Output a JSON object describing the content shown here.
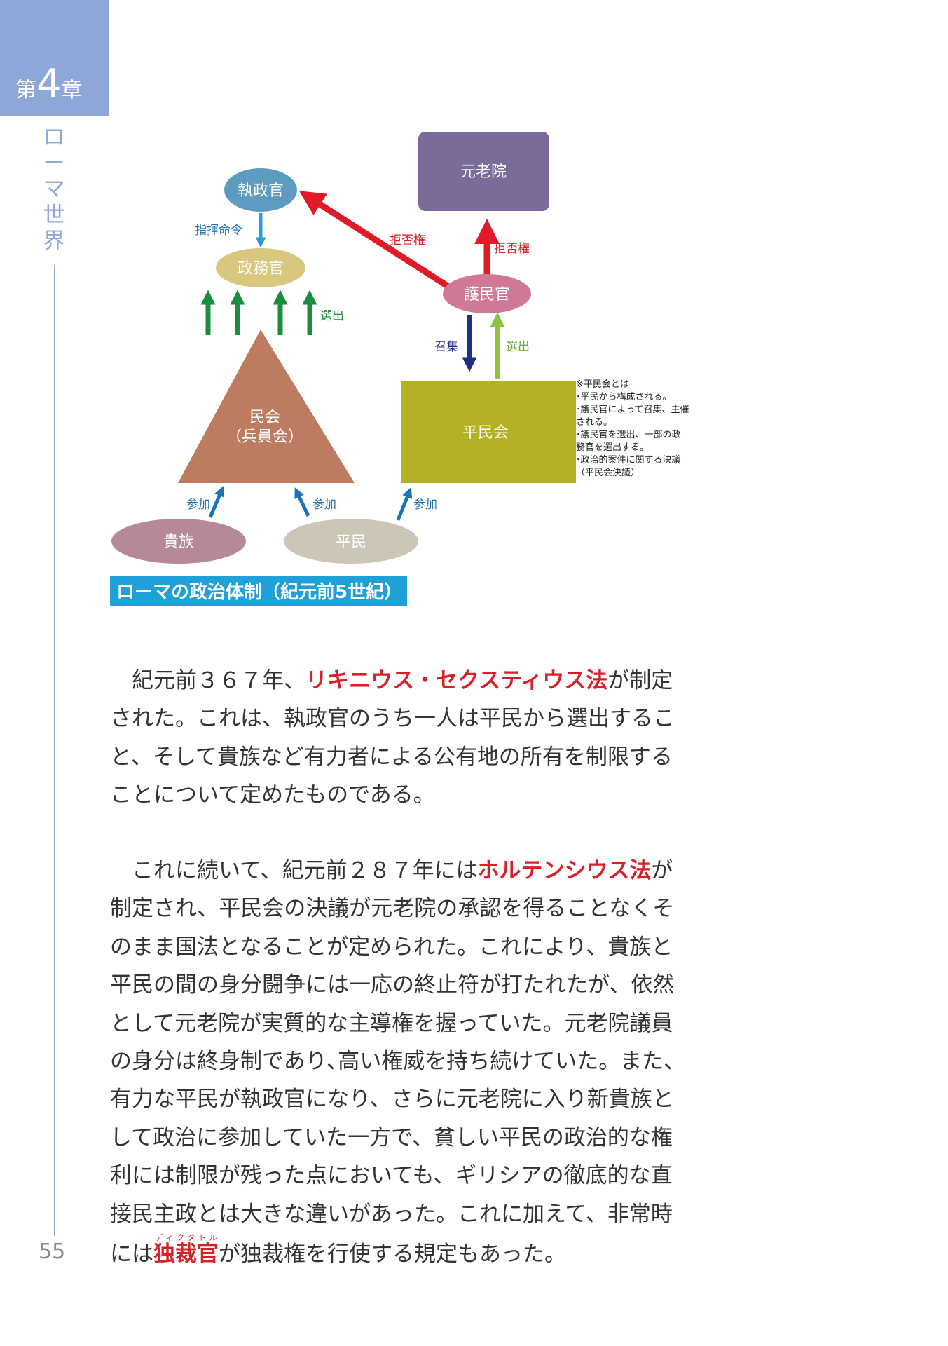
{
  "chapter": {
    "prefix": "第",
    "number": "4",
    "suffix": "章",
    "title": "ローマ世界"
  },
  "page_number": "55",
  "diagram": {
    "nodes": {
      "consul": "執政官",
      "senate": "元老院",
      "magistrates": "政務官",
      "tribune": "護民官",
      "comitia": [
        "民会",
        "（兵員会）"
      ],
      "plebeian_council": "平民会",
      "patricians": "貴族",
      "plebeians": "平民"
    },
    "labels": {
      "command": "指揮命令",
      "veto_consul": "拒否権",
      "veto_senate": "拒否権",
      "elect_magistrates": "選出",
      "convene": "召集",
      "elect_tribune": "選出",
      "join_patricians": "参加",
      "join_plebeians": "参加",
      "join_council": "参加"
    },
    "note": [
      "※平民会とは",
      "･平民から構成される。",
      "･護民官によって召集、主催",
      "される。",
      "･護民官を選出、一部の政",
      "務官を選出する。",
      "･政治的案件に関する決議",
      "（平民会決議）"
    ],
    "caption": "ローマの政治体制（紀元前5世紀）",
    "colors": {
      "consul": "#5d9cc0",
      "senate": "#7a6b99",
      "magistrates": "#d8c87e",
      "tribune": "#d07898",
      "comitia": "#bd7c60",
      "plebeian_council": "#b4b224",
      "patricians": "#b58a96",
      "plebeians": "#cbc6b5",
      "veto_arrow": "#e01b27",
      "elect_arrow": "#1a8e3e",
      "convene_arrow": "#1f2e88",
      "elect_light_arrow": "#8dc43c",
      "join_arrow": "#1a72b8",
      "caption_bg": "#1fa0d8",
      "chapter_tab": "#8ea7d8"
    }
  },
  "paragraph1": {
    "lines": [
      {
        "pre": "　紀元前３６７年、",
        "em": "リキニウス・セクスティウス法",
        "post": "が制定"
      },
      {
        "pre": "された。これは、執政官のうち一人は平民から選出するこ"
      },
      {
        "pre": "と、そして貴族など有力者による公有地の所有を制限する"
      },
      {
        "pre": "ことについて定めたものである。"
      }
    ]
  },
  "paragraph2": {
    "lines": [
      {
        "pre": "　これに続いて、紀元前２８７年には",
        "em": "ホルテンシウス法",
        "post": "が"
      },
      {
        "pre": "制定され、平民会の決議が元老院の承認を得ることなくそ"
      },
      {
        "pre": "のまま国法となることが定められた。これにより、貴族と"
      },
      {
        "pre": "平民の間の身分闘争には一応の終止符が打たれたが、依然"
      },
      {
        "pre": "として元老院が実質的な主導権を握っていた。元老院議員"
      },
      {
        "pre": "の身分は終身制であり､高い権威を持ち続けていた。また、"
      },
      {
        "pre": "有力な平民が執政官になり、さらに元老院に入り新貴族と"
      },
      {
        "pre": "して政治に参加していた一方で、貧しい平民の政治的な権"
      },
      {
        "pre": "利には制限が残った点においても、ギリシアの徹底的な直"
      },
      {
        "pre": "接民主政とは大きな違いがあった。これに加えて、非常時"
      }
    ],
    "last_line": {
      "pre": "には",
      "em": "独裁官",
      "ruby": "ディクタトル",
      "post": "が独裁権を行使する規定もあった。"
    }
  }
}
